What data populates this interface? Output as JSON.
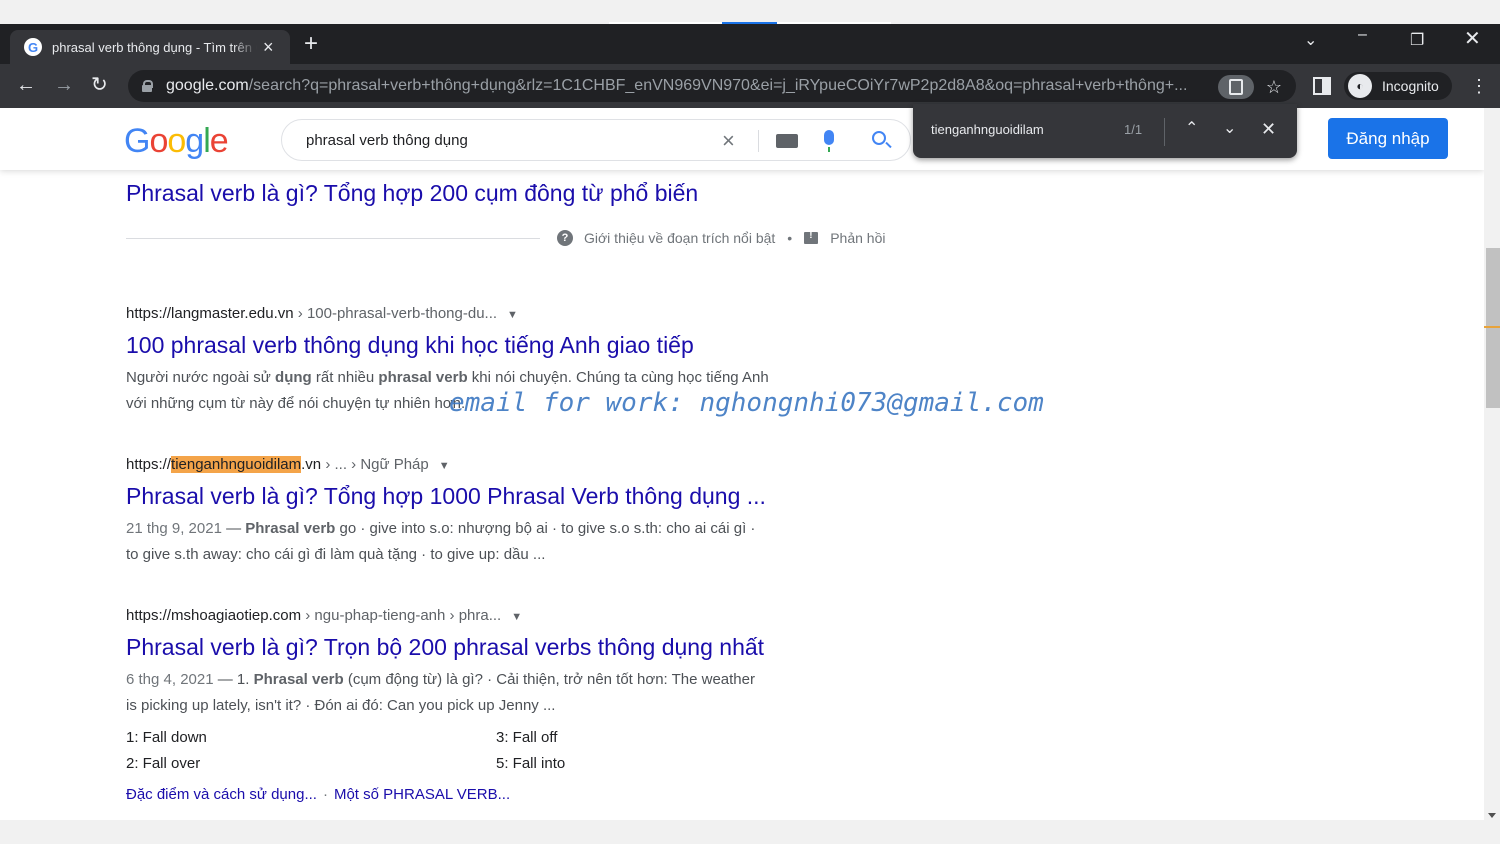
{
  "browser": {
    "tab_title": "phrasal verb thông dụng - Tìm trên Google",
    "favicon_letter": "G",
    "url_domain": "google.com",
    "url_rest": "/search?q=phrasal+verb+thông+dụng&rlz=1C1CHBF_enVN969VN970&ei=j_iRYpueCOiYr7wP2p2d8A8&oq=phrasal+verb+thông+...",
    "profile_label": "Incognito"
  },
  "header": {
    "search_query": "phrasal verb thông dụng",
    "signin_label": "Đăng nhập"
  },
  "find_bar": {
    "query": "tienganhnguoidilam",
    "count": "1/1"
  },
  "featured": {
    "title": "Phrasal verb là gì? Tổng hợp 200 cụm đông từ phổ biến",
    "about_label": "Giới thiệu về đoạn trích nổi bật",
    "feedback_label": "Phản hồi"
  },
  "results": [
    {
      "url_base": "https://langmaster.edu.vn",
      "url_path": " › 100-phrasal-verb-thong-du...",
      "title": "100 phrasal verb thông dụng khi học tiếng Anh giao tiếp",
      "snippet_line1_a": "Người nước ngoài sử ",
      "snippet_line1_b": "dụng",
      "snippet_line1_c": " rất nhiều ",
      "snippet_line1_d": "phrasal verb",
      "snippet_line1_e": " khi nói chuyện. Chúng ta cùng học tiếng Anh",
      "snippet_line2": "với những cụm từ này để nói chuyện tự nhiên hơn."
    },
    {
      "url_prefix": "https://",
      "url_highlight": "tienganhnguoidilam",
      "url_suffix": ".vn",
      "url_path": " › ... › Ngữ Pháp",
      "title": "Phrasal verb là gì? Tổng hợp 1000 Phrasal Verb thông dụng ...",
      "date": "21 thg 9, 2021",
      "snippet_line1_b": "Phrasal verb",
      "snippet_line1_c": " go · give into s.o: nhượng bộ ai · to give s.o s.th: cho ai cái gì ·",
      "snippet_line2": "to give s.th away: cho cái gì đi làm quà tặng · to give up: dầu ..."
    },
    {
      "url_base": "https://mshoagiaotiep.com",
      "url_path": " › ngu-phap-tieng-anh › phra...",
      "title": "Phrasal verb là gì? Trọn bộ 200 phrasal verbs thông dụng nhất",
      "date": "6 thg 4, 2021",
      "snippet_line1_a": "1. ",
      "snippet_line1_b": "Phrasal verb",
      "snippet_line1_c": " (cụm động từ) là gì? · Cải thiện, trở nên tốt hơn: The weather",
      "snippet_line2": "is picking up lately, isn't it? · Đón ai đó: Can you pick up Jenny ...",
      "list": [
        "1: Fall down",
        "3: Fall off",
        "2: Fall over",
        "5: Fall into"
      ],
      "sublinks": [
        "Đặc điểm và cách sử dụng...",
        "Một số PHRASAL VERB..."
      ]
    }
  ],
  "watermark": "email for work: nghongnhi073@gmail.com",
  "colors": {
    "link": "#1a0dab",
    "highlight": "#f4a449",
    "signin": "#1a73e8",
    "chrome_dark": "#202124"
  },
  "icons": [
    "google-favicon-icon",
    "close-icon",
    "plus-icon",
    "back-icon",
    "forward-icon",
    "reload-icon",
    "lock-icon",
    "find-in-page-icon",
    "star-icon",
    "side-panel-icon",
    "incognito-icon",
    "kebab-menu-icon",
    "clear-icon",
    "keyboard-icon",
    "mic-icon",
    "search-icon",
    "apps-icon",
    "chevron-up-icon",
    "chevron-down-icon",
    "question-icon",
    "feedback-icon"
  ]
}
